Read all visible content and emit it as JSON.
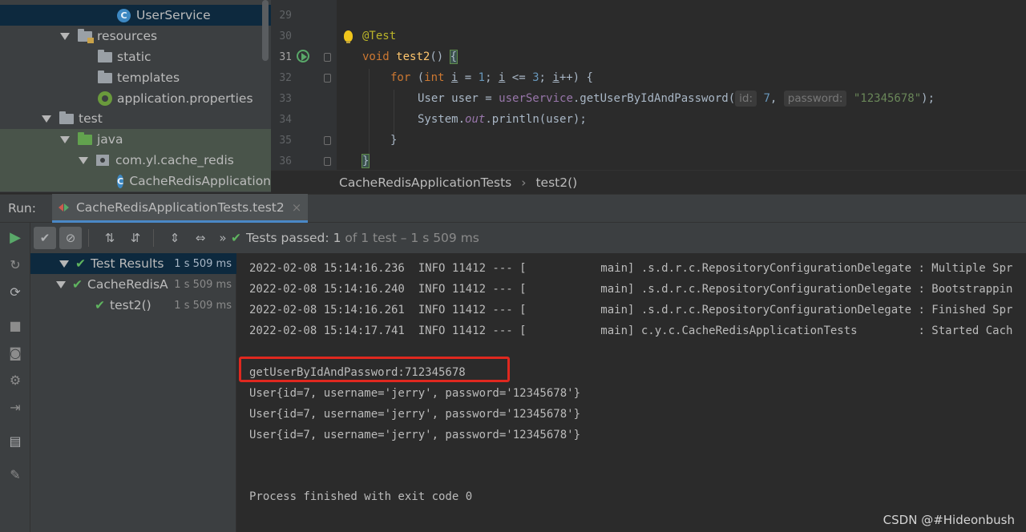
{
  "project_tree": {
    "items": [
      {
        "label": "UserService"
      },
      {
        "label": "resources"
      },
      {
        "label": "static"
      },
      {
        "label": "templates"
      },
      {
        "label": "application.properties"
      },
      {
        "label": "test"
      },
      {
        "label": "java"
      },
      {
        "label": "com.yl.cache_redis"
      },
      {
        "label": "CacheRedisApplication"
      }
    ]
  },
  "gutter": {
    "line_numbers": [
      "29",
      "30",
      "31",
      "32",
      "33",
      "34",
      "35",
      "36"
    ]
  },
  "editor": {
    "annotation": "@Test",
    "kw_void": "void",
    "method_name": "test2",
    "sig_rest": "() ",
    "open_brace": "{",
    "kw_for": "for",
    "for_open": " (",
    "kw_int": "int",
    "var_i": "i",
    "assign": " = ",
    "num_1": "1",
    "cond_sep": "; ",
    "le": " <= ",
    "num_3": "3",
    "inc_sep": "; ",
    "inc_tail": "++) {",
    "decl": "User user = ",
    "field_userService": "userService",
    "call": ".getUserByIdAndPassword(",
    "hint_id": "id:",
    "arg_id": "7",
    "comma": ", ",
    "hint_password": "password:",
    "arg_password": "\"12345678\"",
    "call_end": ");",
    "print_prefix": "System.",
    "print_out": "out",
    "print_suffix": ".println(user);",
    "close_inner": "}",
    "close_outer": "}"
  },
  "breadcrumb": {
    "class_name": "CacheRedisApplicationTests",
    "separator": "›",
    "method": "test2()"
  },
  "run_window": {
    "label": "Run:",
    "tab_title": "CacheRedisApplicationTests.test2",
    "close": "×"
  },
  "test_toolbar": {
    "status_prefix": "Tests passed:",
    "status_count": "1",
    "status_rest": "of 1 test – 1 s 509 ms",
    "more": "»"
  },
  "test_results": {
    "rows": [
      {
        "label": "Test Results",
        "time": "1 s 509 ms"
      },
      {
        "label": "CacheRedisAp",
        "time": "1 s 509 ms"
      },
      {
        "label": "test2()",
        "time": "1 s 509 ms"
      }
    ]
  },
  "console": {
    "lines": [
      "2022-02-08 15:14:16.236  INFO 11412 --- [           main] .s.d.r.c.RepositoryConfigurationDelegate : Multiple Spr",
      "2022-02-08 15:14:16.240  INFO 11412 --- [           main] .s.d.r.c.RepositoryConfigurationDelegate : Bootstrappin",
      "2022-02-08 15:14:16.261  INFO 11412 --- [           main] .s.d.r.c.RepositoryConfigurationDelegate : Finished Spr",
      "2022-02-08 15:14:17.741  INFO 11412 --- [           main] c.y.c.CacheRedisApplicationTests         : Started Cach",
      "getUserByIdAndPassword:712345678",
      "User{id=7, username='jerry', password='12345678'}",
      "User{id=7, username='jerry', password='12345678'}",
      "User{id=7, username='jerry', password='12345678'}",
      "Process finished with exit code 0"
    ]
  },
  "watermark": "CSDN @#Hideonbush"
}
